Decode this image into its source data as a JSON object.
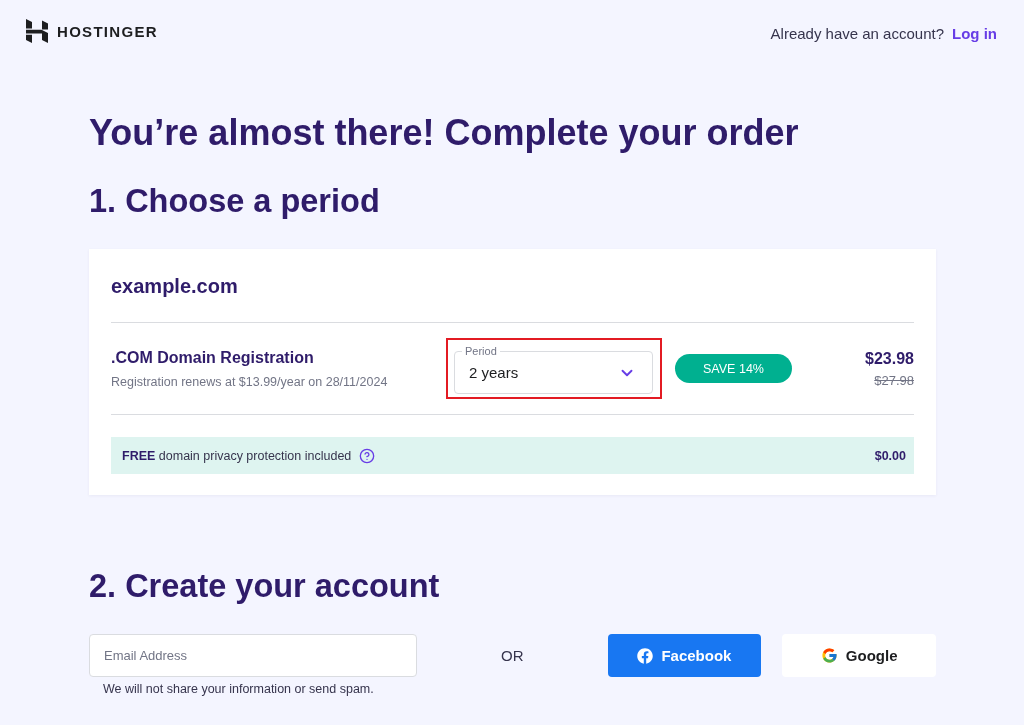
{
  "header": {
    "logo_text": "HOSTINGER",
    "account_prompt": "Already have an account?",
    "login_link": "Log in"
  },
  "title": "You’re almost there! Complete your order",
  "period_section": {
    "heading": "1. Choose a period",
    "card": {
      "domain": "example.com",
      "product": {
        "name": ".COM Domain Registration",
        "renewal": "Registration renews at $13.99/year on 28/11/2024",
        "period": {
          "label": "Period",
          "value": "2 years",
          "highlighted": true
        },
        "badge": "SAVE 14%",
        "price": "$23.98",
        "old_price": "$27.98"
      },
      "privacy": {
        "text": "**FREE** domain privacy protection included",
        "price": "$0.00"
      }
    }
  },
  "account_section": {
    "heading": "2. Create your account",
    "email": {
      "placeholder": "Email Address",
      "hint": "We will not share your information or send spam."
    },
    "separator": "OR",
    "social_buttons": [
      {
        "kind": "facebook",
        "label": "Facebook"
      },
      {
        "kind": "google",
        "label": "Google"
      }
    ]
  }
}
